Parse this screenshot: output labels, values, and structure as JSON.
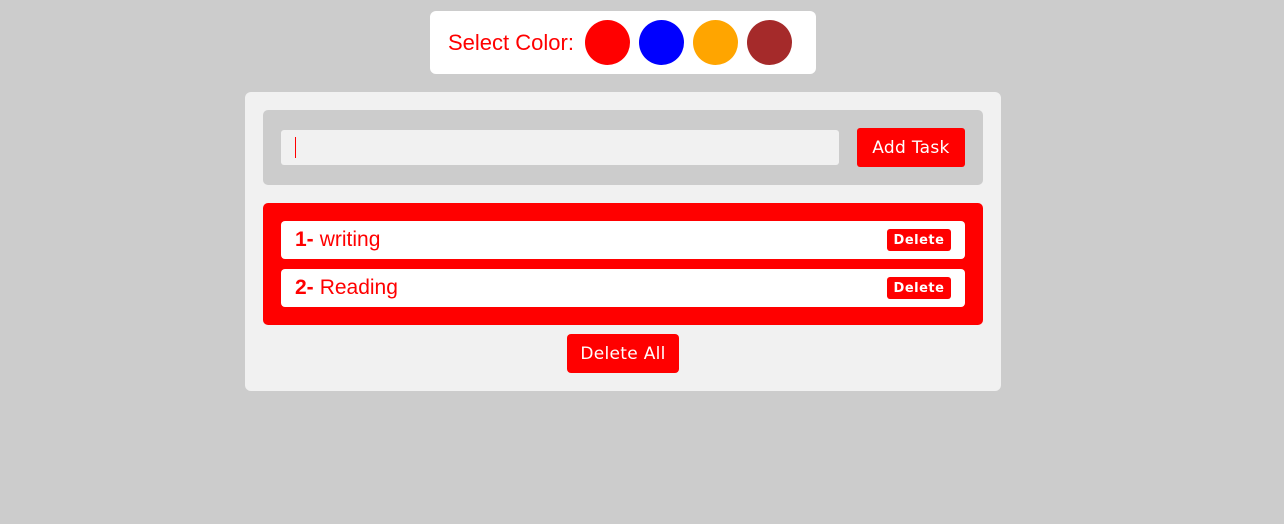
{
  "color_picker": {
    "label": "Select Color:",
    "colors": [
      "#ff0000",
      "#0000ff",
      "#ffa500",
      "#a52a2a"
    ]
  },
  "form": {
    "input_value": "",
    "add_label": "Add Task"
  },
  "tasks": [
    {
      "number": "1-",
      "text": "writing",
      "delete_label": "Delete"
    },
    {
      "number": "2-",
      "text": "Reading",
      "delete_label": "Delete"
    }
  ],
  "delete_all_label": "Delete All",
  "accent_color": "#ff0000"
}
